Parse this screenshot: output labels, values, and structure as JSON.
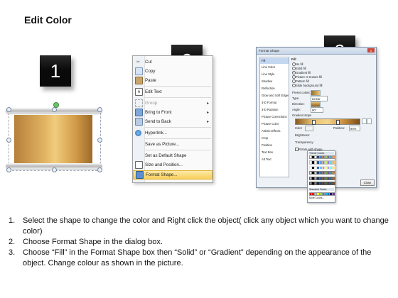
{
  "title": "Edit Color",
  "steps_badges": [
    "1",
    "2",
    "3"
  ],
  "context_menu": {
    "items": [
      {
        "label": "Cut",
        "icon": "scissors-icon",
        "disabled": false,
        "submenu": false
      },
      {
        "label": "Copy",
        "icon": "copy-icon",
        "disabled": false,
        "submenu": false
      },
      {
        "label": "Paste",
        "icon": "paste-icon",
        "disabled": false,
        "submenu": false
      },
      {
        "label": "Edit Text",
        "icon": "edit-text-icon",
        "disabled": false,
        "submenu": false
      },
      {
        "label": "Group",
        "icon": "group-icon",
        "disabled": true,
        "submenu": true
      },
      {
        "label": "Bring to Front",
        "icon": "bring-front-icon",
        "disabled": false,
        "submenu": true
      },
      {
        "label": "Send to Back",
        "icon": "send-back-icon",
        "disabled": false,
        "submenu": true
      },
      {
        "label": "Hyperlink...",
        "icon": "hyperlink-icon",
        "disabled": false,
        "submenu": false
      },
      {
        "label": "Save as Picture...",
        "icon": "",
        "disabled": false,
        "submenu": false
      },
      {
        "label": "Set as Default Shape",
        "icon": "",
        "disabled": false,
        "submenu": false
      },
      {
        "label": "Size and Position...",
        "icon": "size-icon",
        "disabled": false,
        "submenu": false
      },
      {
        "label": "Format Shape...",
        "icon": "format-shape-icon",
        "disabled": false,
        "submenu": false,
        "highlighted": true
      }
    ]
  },
  "dialog": {
    "title": "Format Shape",
    "close_label": "x",
    "nav": [
      "Fill",
      "Line Color",
      "Line Style",
      "Shadow",
      "Reflection",
      "Glow and Soft Edges",
      "3-D Format",
      "3-D Rotation",
      "Picture Corrections",
      "Picture Color",
      "Artistic Effects",
      "Crop",
      "Position",
      "Text Box",
      "Alt Text"
    ],
    "fill_heading": "Fill",
    "fill_options": [
      "No fill",
      "Solid fill",
      "Gradient fill",
      "Picture or texture fill",
      "Pattern fill",
      "Slide background fill"
    ],
    "selected_fill": "Gradient fill",
    "preset_colors_label": "Preset colors:",
    "type_label": "Type:",
    "type_value": "Linear",
    "direction_label": "Direction:",
    "angle_label": "Angle:",
    "angle_value": "90°",
    "gradient_stops_label": "Gradient stops",
    "color_label": "Color",
    "position_label": "Position:",
    "position_value": "94%",
    "brightness_label": "Brightness:",
    "transparency_label": "Transparency:",
    "rotate_label": "Rotate with shape",
    "theme_colors_label": "Theme Colors",
    "standard_colors_label": "Standard Colors",
    "more_colors_label": "More Colors...",
    "close_button": "Close"
  },
  "instructions": [
    {
      "num": "1.",
      "text": "Select the shape to change the color and Right click the object( click any object which you want to change color)"
    },
    {
      "num": "2.",
      "text": "Choose Format Shape in the dialog box."
    },
    {
      "num": "3.",
      "text": "Choose “Fill” in the Format Shape box then “Solid” or “Gradient” depending on the appearance of the object. Change colour as shown in the picture."
    }
  ],
  "colors": {
    "badge_bg": "#0a0a0a",
    "scroll_gold": "#e2b564",
    "menu_highlight": "#f7cf5a",
    "dialog_bg": "#eef2f7"
  }
}
